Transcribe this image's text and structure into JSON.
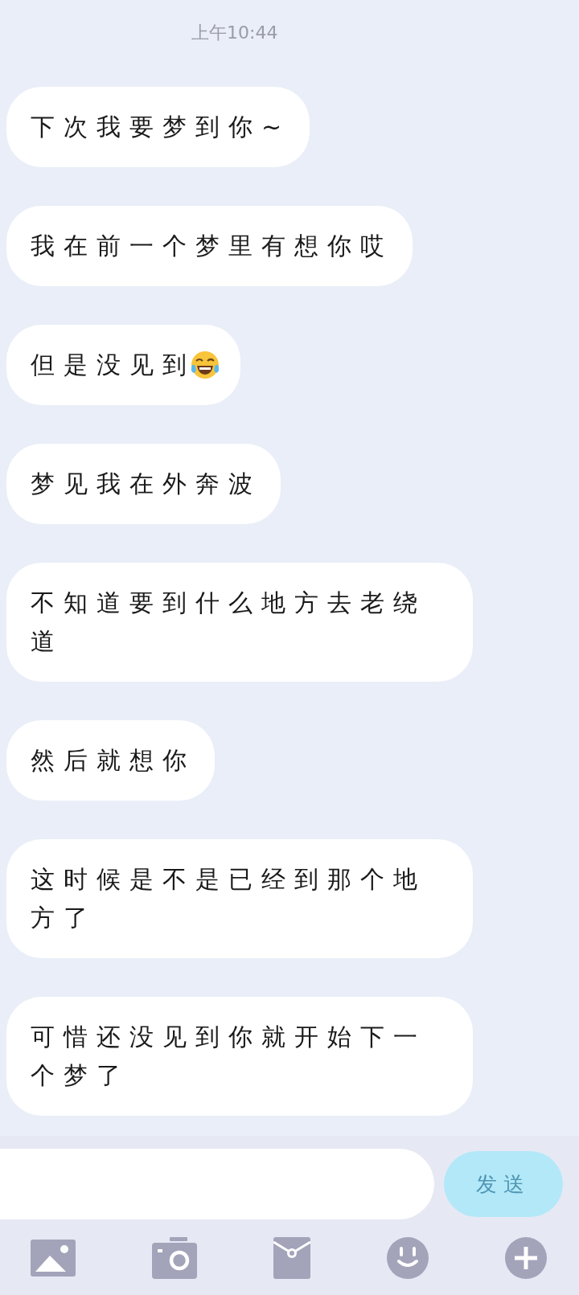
{
  "timestamp": "上午10:44",
  "messages": [
    {
      "text": "下次我要梦到你~",
      "trailing_emoji": false
    },
    {
      "text": "我在前一个梦里有想你哎",
      "trailing_emoji": false
    },
    {
      "text": "但是没见到",
      "trailing_emoji": true
    },
    {
      "text": "梦见我在外奔波",
      "trailing_emoji": false
    },
    {
      "text": "不知道要到什么地方去老绕道",
      "trailing_emoji": false
    },
    {
      "text": "然后就想你",
      "trailing_emoji": false
    },
    {
      "text": "这时候是不是已经到那个地方了",
      "trailing_emoji": false
    },
    {
      "text": "可惜还没见到你就开始下一个梦了",
      "trailing_emoji": false
    }
  ],
  "send_button": {
    "label": "发送",
    "disabled": true
  },
  "toolbar": [
    {
      "kind": "image"
    },
    {
      "kind": "camera"
    },
    {
      "kind": "envelope"
    },
    {
      "kind": "smiley"
    },
    {
      "kind": "plus"
    }
  ]
}
